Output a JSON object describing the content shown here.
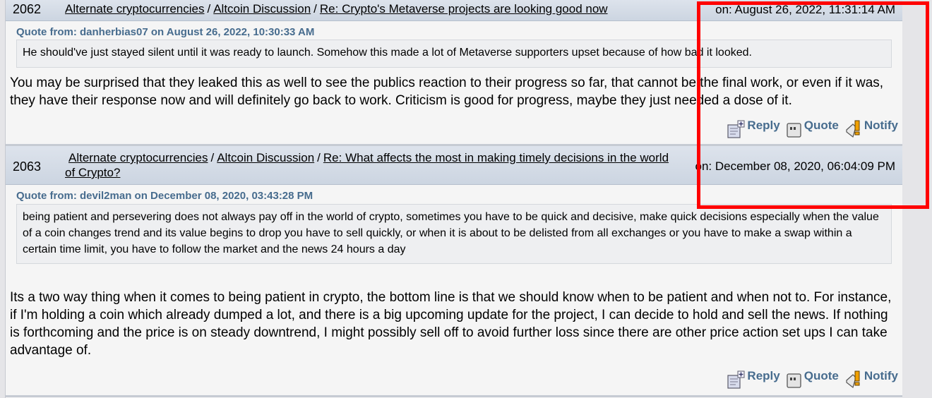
{
  "posts": [
    {
      "number": "2062",
      "breadcrumb": [
        "Alternate cryptocurrencies",
        "Altcoin Discussion",
        "Re: Crypto's Metaverse projects are looking good now"
      ],
      "separator": "/",
      "date": "on: August 26, 2022, 11:31:14 AM",
      "quote_header": "Quote from: danherbias07 on August 26, 2022, 10:30:33 AM",
      "quote_text": "He should've just stayed silent until it was ready to launch. Somehow this made a lot of Metaverse supporters upset because of how bad it looked.",
      "body": "You may be surprised that they leaked this as well to see the publics reaction to their progress so far, that cannot be the final work, or even if it was, they have their response now and will definitely go back to work. Criticism is good for progress, maybe they just needed a dose of it."
    },
    {
      "number": "2063",
      "breadcrumb": [
        "Alternate cryptocurrencies",
        "Altcoin Discussion",
        "Re: What affects the most in making timely decisions in the world of Crypto?"
      ],
      "separator": "/",
      "date": "on: December 08, 2020, 06:04:09 PM",
      "quote_header": "Quote from: devil2man on December 08, 2020, 03:43:28 PM",
      "quote_text": "being patient and persevering does not always pay off in the world of crypto, sometimes you have to be quick and decisive, make quick decisions especially when the value of a coin changes trend and its value begins to drop you have to sell quickly, or when it is about to be delisted from all exchanges or you have to make a swap within a certain time limit, you have to follow the market and the news 24 hours a day",
      "body": "Its a two way thing when it comes to being patient in crypto, the bottom line is that we should know when to be patient and when not to. For instance, if I'm holding a coin which already dumped a lot, and there is a big upcoming update for the project, I can decide to hold and sell the news. If nothing is forthcoming and the price is on steady downtrend, I might possibly sell off to avoid further loss since there are other price action set ups I can take advantage of."
    }
  ],
  "actions": {
    "reply": "Reply",
    "quote": "Quote",
    "notify": "Notify"
  },
  "icons": [
    "reply-icon",
    "quote-icon",
    "notify-icon"
  ],
  "colors": {
    "link_accent": "#476c8e",
    "highlight_box": "#ff0000",
    "header_bg": "#d4dce6"
  }
}
